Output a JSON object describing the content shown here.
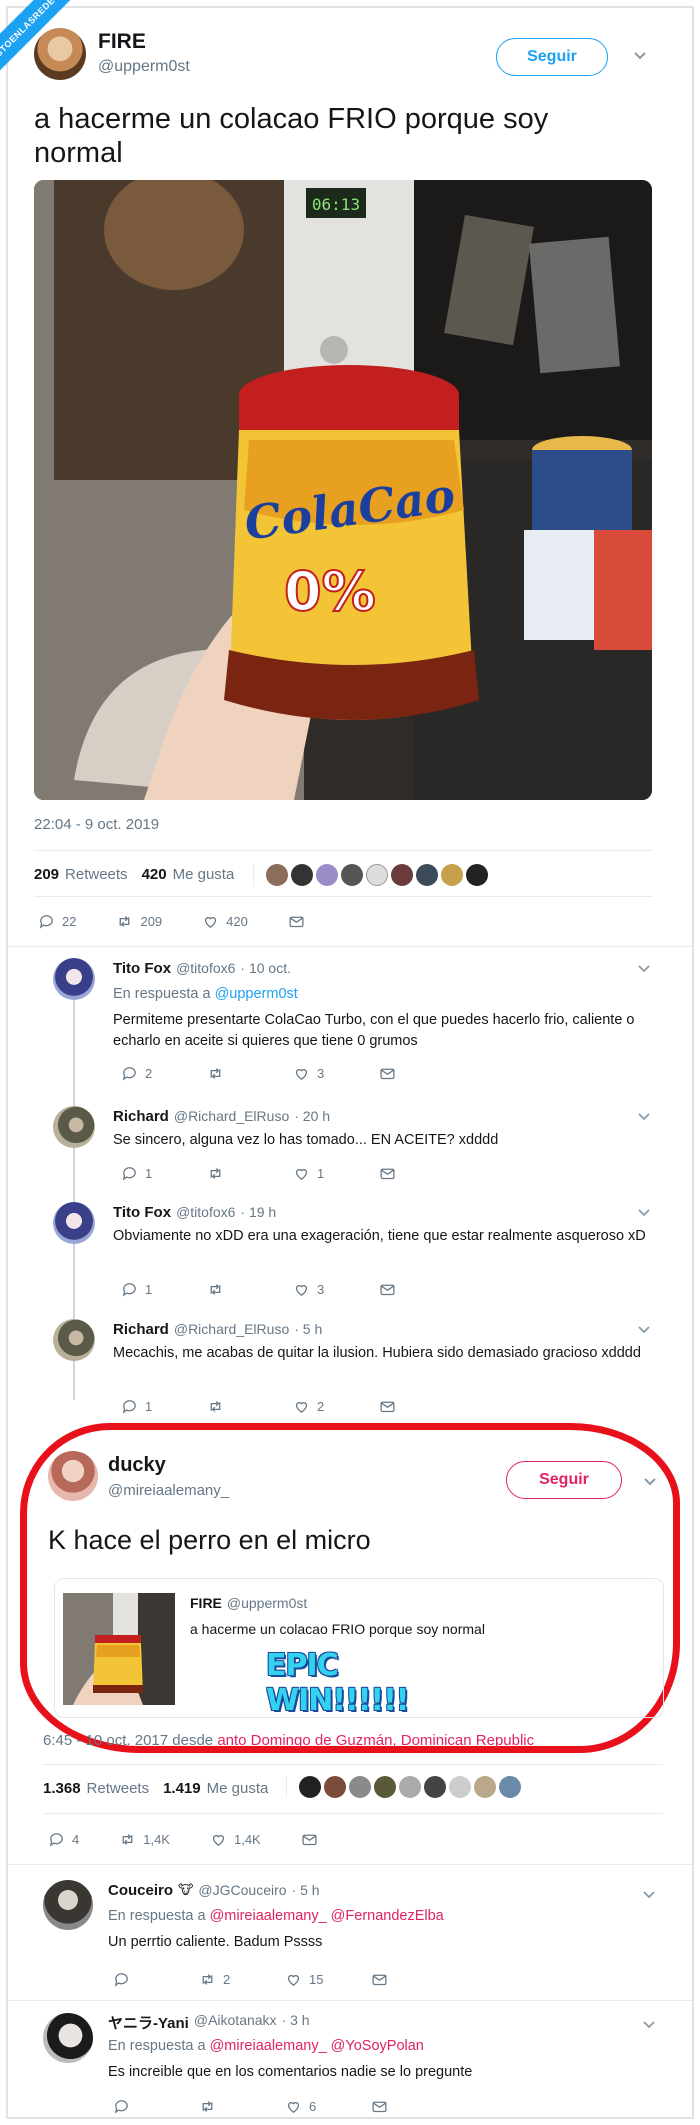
{
  "watermark": "VISTOENLASREDES.COM",
  "colors": {
    "accent": "#1da1f2",
    "mention_red": "#e0245e",
    "highlight_circle": "#e8111b",
    "epic_text": "#33d3f0"
  },
  "main_tweet": {
    "name": "FIRE",
    "handle": "@upperm0st",
    "follow_label": "Seguir",
    "text": "a hacerme un colacao FRIO porque soy normal",
    "photo": {
      "clock": "06:13",
      "jar_brand": "ColaCao",
      "jar_variant": "0%"
    },
    "timestamp": "22:04 - 9 oct. 2019",
    "retweets": "209",
    "retweets_label": "Retweets",
    "likes": "420",
    "likes_label": "Me gusta",
    "reply_count": "22",
    "retweet_count": "209",
    "like_count": "420"
  },
  "replies": [
    {
      "name": "Tito Fox",
      "handle": "@titofox6",
      "time": "· 10 oct.",
      "reply_to_prefix": "En respuesta a",
      "reply_to": "@upperm0st",
      "text": "Permiteme presentarte ColaCao Turbo, con el que puedes hacerlo frio, caliente o echarlo en aceite si quieres que tiene 0 grumos",
      "replies": "2",
      "retweets": "",
      "likes": "3"
    },
    {
      "name": "Richard",
      "handle": "@Richard_ElRuso",
      "time": "· 20 h",
      "text": "Se sincero, alguna vez lo has tomado... EN ACEITE? xdddd",
      "replies": "1",
      "retweets": "",
      "likes": "1"
    },
    {
      "name": "Tito Fox",
      "handle": "@titofox6",
      "time": "· 19 h",
      "text": "Obviamente no xDD era una exageración, tiene que estar realmente asqueroso xD",
      "replies": "1",
      "retweets": "",
      "likes": "3"
    },
    {
      "name": "Richard",
      "handle": "@Richard_ElRuso",
      "time": "· 5 h",
      "text": "Mecachis, me acabas de quitar la ilusion. Hubiera sido demasiado gracioso xdddd",
      "replies": "1",
      "retweets": "",
      "likes": "2"
    }
  ],
  "second_tweet": {
    "name": "ducky",
    "handle": "@mireiaalemany_",
    "follow_label": "Seguir",
    "text": "K hace el perro en el micro",
    "quote": {
      "name": "FIRE",
      "handle": "@upperm0st",
      "text": "a hacerme un colacao FRIO porque soy normal"
    },
    "overlay": "EPIC WIN!!!!!!",
    "timestamp": "6:45 - 10 oct. 2017 desde",
    "location": "anto Domingo de Guzmán, Dominican Republic",
    "retweets": "1.368",
    "retweets_label": "Retweets",
    "likes": "1.419",
    "likes_label": "Me gusta",
    "reply_count": "4",
    "retweet_count": "1,4K",
    "like_count": "1,4K"
  },
  "second_replies": [
    {
      "name": "Couceiro",
      "badge": "🐮",
      "handle": "@JGCouceiro",
      "time": "· 5 h",
      "reply_to_prefix": "En respuesta a",
      "reply_to": "@mireiaalemany_ @FernandezElba",
      "text": "Un perrtio caliente.  Badum Pssss",
      "replies": "",
      "retweets": "2",
      "likes": "15"
    },
    {
      "name": "ヤニラ-Yani",
      "handle": "@Aikotanakx",
      "time": "· 3 h",
      "reply_to_prefix": "En respuesta a",
      "reply_to": "@mireiaalemany_ @YoSoyPolan",
      "text": "Es increible que en los comentarios nadie se lo pregunte",
      "replies": "",
      "retweets": "",
      "likes": "6"
    }
  ]
}
